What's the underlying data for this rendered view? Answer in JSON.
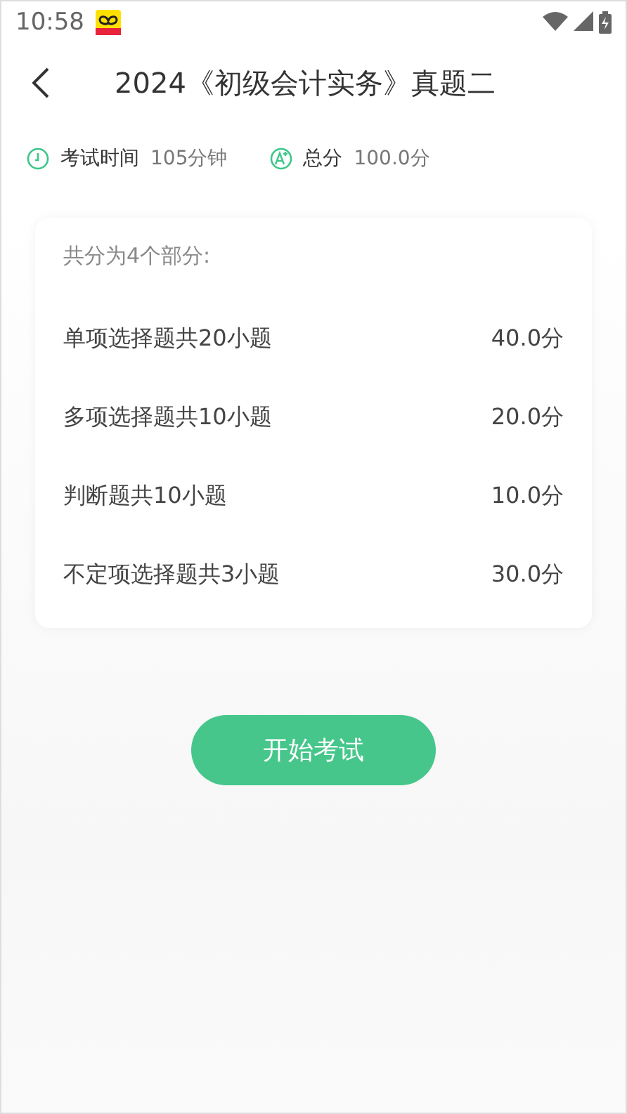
{
  "status_bar": {
    "time": "10:58"
  },
  "header": {
    "title": "2024《初级会计实务》真题二"
  },
  "info": [
    {
      "kind": "time",
      "label": "考试时间",
      "value": "105分钟"
    },
    {
      "kind": "score",
      "label": "总分",
      "value": "100.0分"
    }
  ],
  "sections": {
    "summary": "共分为4个部分:",
    "rows": [
      {
        "name": "单项选择题共20小题",
        "score": "40.0分"
      },
      {
        "name": "多项选择题共10小题",
        "score": "20.0分"
      },
      {
        "name": "判断题共10小题",
        "score": "10.0分"
      },
      {
        "name": "不定项选择题共3小题",
        "score": "30.0分"
      }
    ]
  },
  "start_button": "开始考试"
}
